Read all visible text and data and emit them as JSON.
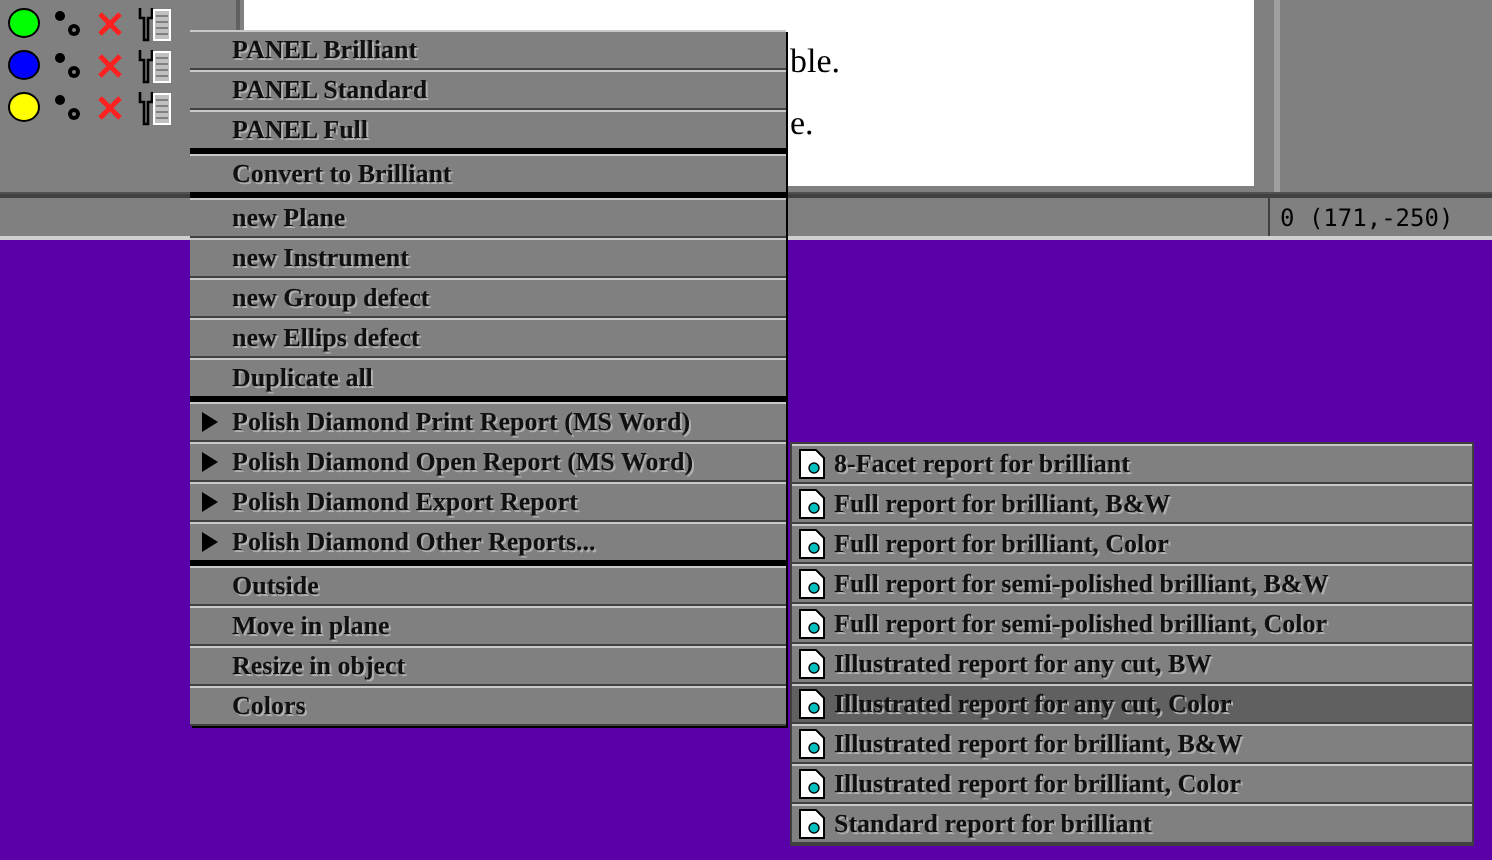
{
  "object_rows": [
    {
      "color": "#00ff00"
    },
    {
      "color": "#0000ff"
    },
    {
      "color": "#ffff00"
    }
  ],
  "document": {
    "lines": [
      "ble.",
      "e."
    ]
  },
  "status_bar": {
    "coordinates": "0 (171,-250)"
  },
  "context_menu": {
    "items": [
      {
        "label": "PANEL Brilliant",
        "submenu": false,
        "separator_after": false
      },
      {
        "label": "PANEL Standard",
        "submenu": false,
        "separator_after": false
      },
      {
        "label": "PANEL Full",
        "submenu": false,
        "separator_after": true
      },
      {
        "label": "Convert to Brilliant",
        "submenu": false,
        "separator_after": true
      },
      {
        "label": "new Plane",
        "submenu": false,
        "separator_after": false
      },
      {
        "label": "new Instrument",
        "submenu": false,
        "separator_after": false
      },
      {
        "label": "new Group defect",
        "submenu": false,
        "separator_after": false
      },
      {
        "label": "new Ellips defect",
        "submenu": false,
        "separator_after": false
      },
      {
        "label": "Duplicate all",
        "submenu": false,
        "separator_after": true
      },
      {
        "label": "Polish Diamond Print Report (MS Word)",
        "submenu": true,
        "separator_after": false
      },
      {
        "label": "Polish Diamond Open Report (MS Word)",
        "submenu": true,
        "separator_after": false
      },
      {
        "label": "Polish Diamond Export Report",
        "submenu": true,
        "separator_after": false
      },
      {
        "label": "Polish Diamond Other Reports...",
        "submenu": true,
        "separator_after": true
      },
      {
        "label": "Outside",
        "submenu": false,
        "separator_after": false
      },
      {
        "label": "Move in plane",
        "submenu": false,
        "separator_after": false
      },
      {
        "label": "Resize in object",
        "submenu": false,
        "separator_after": false
      },
      {
        "label": "Colors",
        "submenu": false,
        "separator_after": false
      }
    ]
  },
  "submenu": {
    "items": [
      {
        "label": "8-Facet report for brilliant",
        "selected": false
      },
      {
        "label": "Full report for brilliant, B&W",
        "selected": false
      },
      {
        "label": "Full report for brilliant, Color",
        "selected": false
      },
      {
        "label": "Full report for semi-polished brilliant, B&W",
        "selected": false
      },
      {
        "label": "Full report for semi-polished brilliant, Color",
        "selected": false
      },
      {
        "label": "Illustrated report for any cut, BW",
        "selected": false
      },
      {
        "label": "Illustrated report for any cut, Color",
        "selected": true
      },
      {
        "label": "Illustrated report for brilliant, B&W",
        "selected": false
      },
      {
        "label": "Illustrated report for brilliant, Color",
        "selected": false
      },
      {
        "label": "Standard report for brilliant",
        "selected": false
      }
    ]
  }
}
